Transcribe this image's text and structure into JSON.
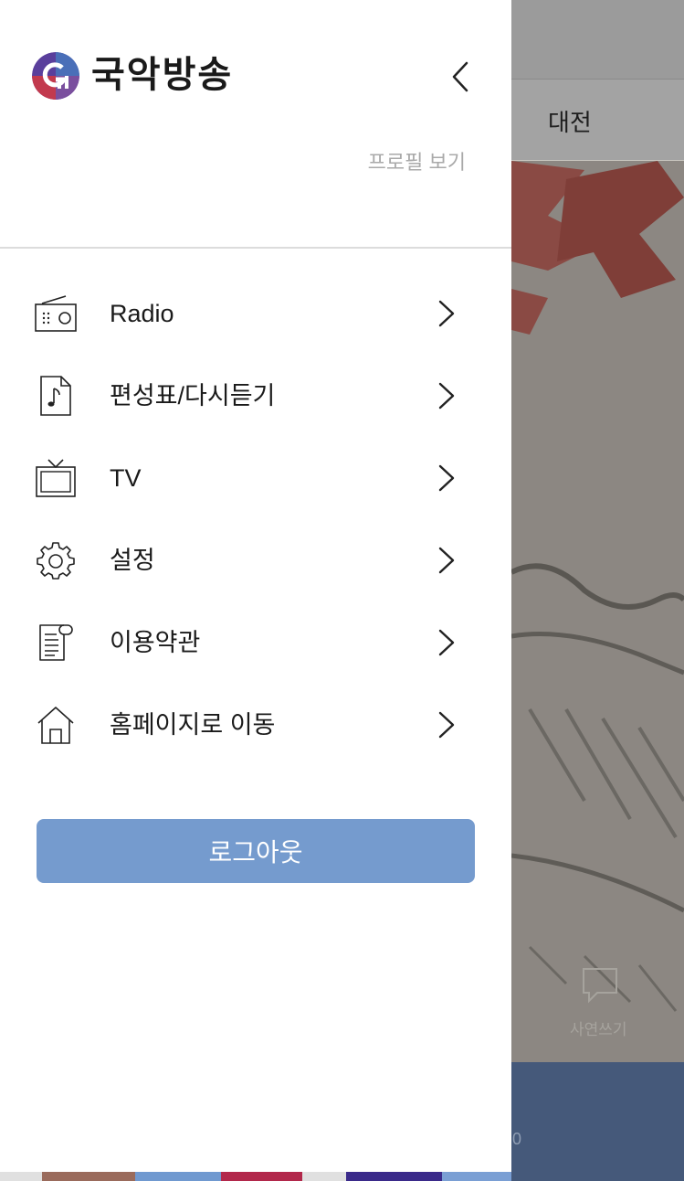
{
  "background": {
    "region_label": "대전",
    "write_label": "사연쓰기",
    "bottom_number": "0"
  },
  "drawer": {
    "brand_name": "국악방송",
    "profile_link": "프로필 보기",
    "menu": [
      {
        "label": "Radio",
        "icon": "radio-icon"
      },
      {
        "label": "편성표/다시듣기",
        "icon": "music-document-icon"
      },
      {
        "label": "TV",
        "icon": "tv-icon"
      },
      {
        "label": "설정",
        "icon": "gear-icon"
      },
      {
        "label": "이용약관",
        "icon": "terms-scroll-icon"
      },
      {
        "label": "홈페이지로 이동",
        "icon": "home-icon"
      }
    ],
    "logout_label": "로그아웃"
  },
  "colors": {
    "logout_bg": "#759bce",
    "bottom_bar": "#45597a",
    "logo_purple": "#5a3f9c",
    "logo_red": "#c23a4e",
    "logo_blue": "#4a6fb8"
  }
}
